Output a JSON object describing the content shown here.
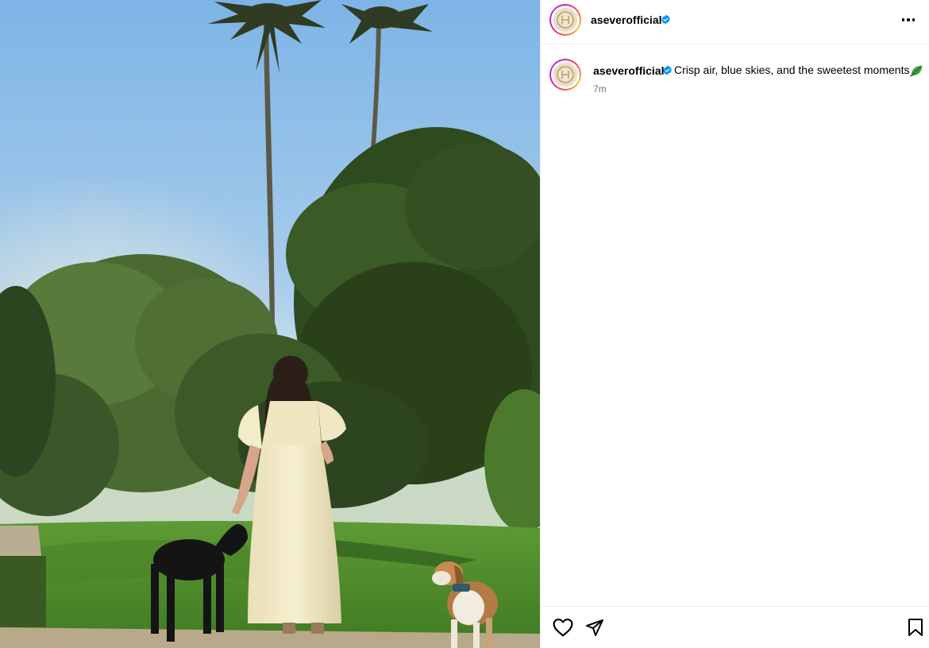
{
  "post": {
    "header": {
      "username": "aseverofficial",
      "avatar_icon": "avatar-icon",
      "verified_icon": "verified-badge-icon",
      "more_icon": "more-options-icon"
    },
    "caption": {
      "username": "aseverofficial",
      "text": "Crisp air, blue skies, and the sweetest moments",
      "emoji_icon": "leaf-emoji-icon",
      "time": "7m"
    },
    "actions": {
      "like_icon": "heart-icon",
      "share_icon": "send-icon",
      "save_icon": "bookmark-icon"
    }
  },
  "colors": {
    "verified": "#0095f6",
    "muted_text": "#737373",
    "divider": "#efefef"
  }
}
